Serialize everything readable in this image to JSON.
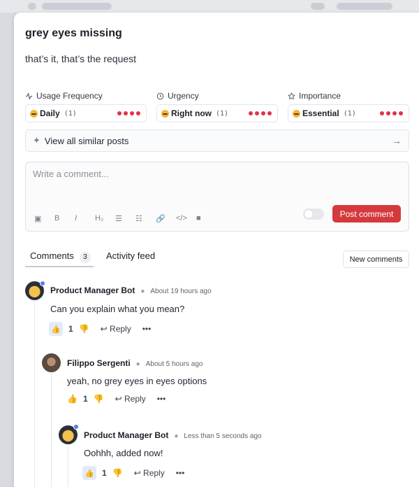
{
  "post": {
    "title": "grey eyes missing",
    "description": "that’s it, that’s the request"
  },
  "properties": [
    {
      "label": "Usage Frequency",
      "icon": "activity-icon",
      "value": "Daily",
      "count": "(1)",
      "level": 4
    },
    {
      "label": "Urgency",
      "icon": "clock-icon",
      "value": "Right now",
      "count": "(1)",
      "level": 4
    },
    {
      "label": "Importance",
      "icon": "star-icon",
      "value": "Essential",
      "count": "(1)",
      "level": 4
    }
  ],
  "similar": {
    "label": "View all similar posts"
  },
  "editor": {
    "placeholder": "Write a comment...",
    "post_label": "Post comment",
    "tools": [
      "image-icon",
      "bold-icon",
      "italic-icon",
      "heading-icon",
      "bullet-list-icon",
      "numbered-list-icon",
      "link-icon",
      "code-icon",
      "video-icon"
    ],
    "tool_glyphs": [
      "▣",
      "B",
      "I",
      "H₂",
      "☰",
      "☷",
      "🔗",
      "</>",
      "■"
    ]
  },
  "tabs": {
    "comments_label": "Comments",
    "comments_count": "3",
    "activity_label": "Activity feed",
    "new_comments_label": "New comments"
  },
  "comments": [
    {
      "author": "Product Manager Bot",
      "time": "About 19 hours ago",
      "text": "Can you explain what you mean?",
      "likes": "1",
      "reply": "Reply"
    },
    {
      "author": "Filippo Sergenti",
      "time": "About 5 hours ago",
      "text": "yeah, no grey eyes in eyes options",
      "likes": "1",
      "reply": "Reply"
    },
    {
      "author": "Product Manager Bot",
      "time": "Less than 5 seconds ago",
      "text": "Oohhh, added now!",
      "likes": "1",
      "reply": "Reply"
    }
  ],
  "colors": {
    "accent": "#d43a3d",
    "dot": "#e0334a",
    "like_bg": "#e3ebf8"
  }
}
